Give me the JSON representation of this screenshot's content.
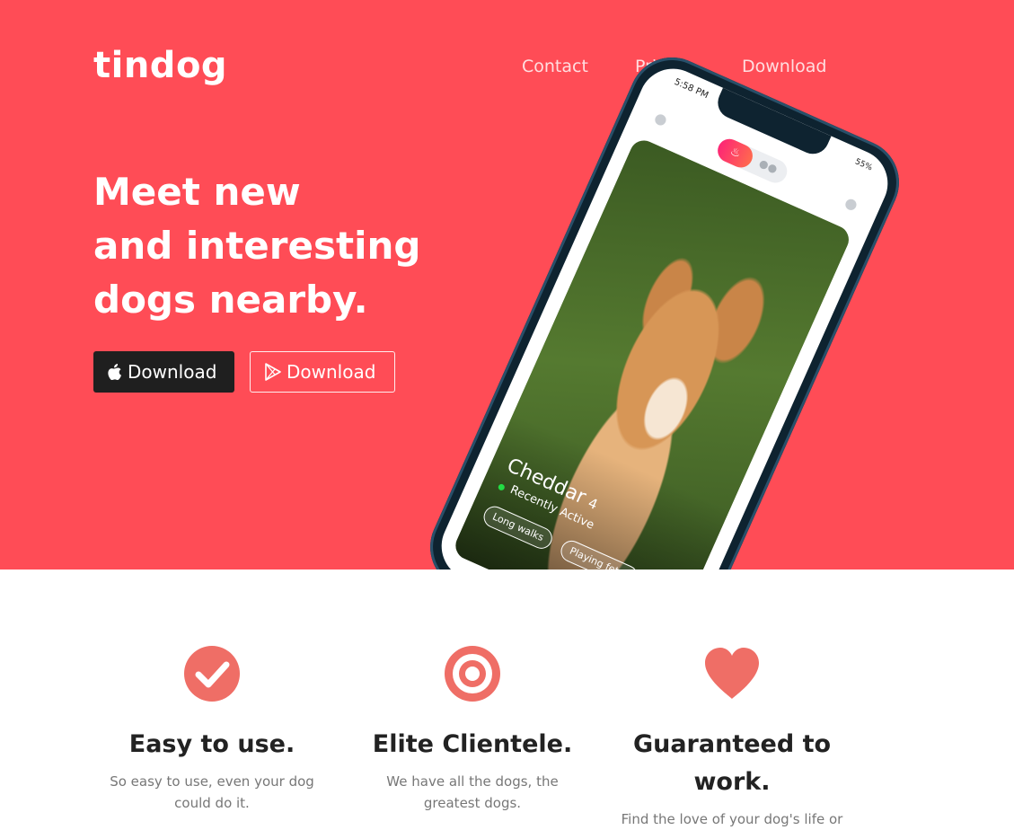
{
  "brand": "tindog",
  "nav": [
    {
      "label": "Contact"
    },
    {
      "label": "Pricing"
    },
    {
      "label": "Download"
    }
  ],
  "hero": {
    "headline_lines": [
      "Meet new",
      "and interesting",
      "dogs nearby."
    ],
    "download_apple_label": "Download",
    "download_play_label": "Download",
    "background_color": "#ff4c56"
  },
  "phone": {
    "time": "5:58 PM",
    "battery": "55%",
    "profile_name": "Cheddar",
    "profile_age": "4",
    "status": "Recently Active",
    "tags": [
      "Long walks",
      "Playing fetch"
    ]
  },
  "features": [
    {
      "icon": "check-circle-icon",
      "title": "Easy to use.",
      "text": "So easy to use, even your dog could do it."
    },
    {
      "icon": "bullseye-icon",
      "title": "Elite Clientele.",
      "text": "We have all the dogs, the greatest dogs."
    },
    {
      "icon": "heart-icon",
      "title": "Guaranteed to work.",
      "text": "Find the love of your dog's life or"
    }
  ],
  "accent_color": "#ef6e66"
}
